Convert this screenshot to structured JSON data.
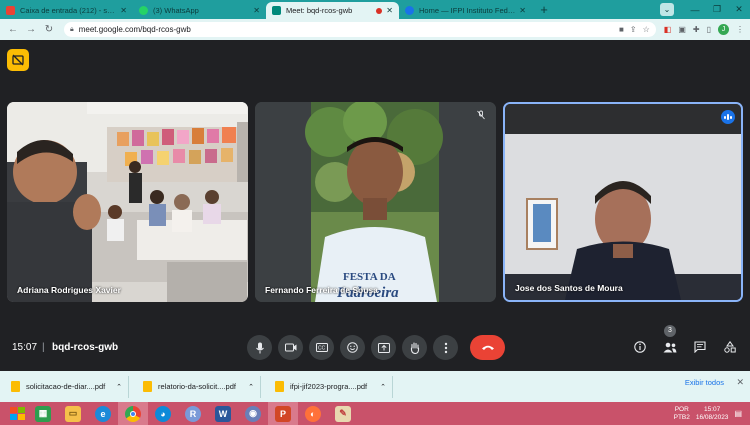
{
  "browser": {
    "tabs": [
      {
        "title": "Caixa de entrada (212) - santos.moura...",
        "icon_color": "#ea4335",
        "active": false
      },
      {
        "title": "(3) WhatsApp",
        "icon_color": "#25d366",
        "active": false
      },
      {
        "title": "Meet: bqd-rcos-gwb",
        "icon_color": "#00897b",
        "active": true,
        "recording": true
      },
      {
        "title": "Home — IFPI Instituto Federal de Edu...",
        "icon_color": "#1a73e8",
        "active": false
      }
    ],
    "url": "meet.google.com/bqd-rcos-gwb",
    "profile_initial": "J"
  },
  "meet": {
    "participants": [
      {
        "name": "Adriana Rodrigues Xavier"
      },
      {
        "name": "Fernando Ferreira de Sousa",
        "muted": true
      },
      {
        "name": "Jose dos Santos de Moura",
        "speaking": true
      }
    ],
    "time": "15:07",
    "separator": "|",
    "meeting_code": "bqd-rcos-gwb",
    "people_count": "3",
    "accent": "#8ab4f8",
    "end_call_color": "#ea4335"
  },
  "downloads": {
    "items": [
      {
        "name": "solicitacao-de-diar....pdf"
      },
      {
        "name": "relatorio-da-solicit....pdf"
      },
      {
        "name": "ifpi-jif2023-progra....pdf"
      }
    ],
    "show_all": "Exibir todos"
  },
  "taskbar": {
    "lang1": "POR",
    "lang2": "PTB2",
    "time": "15:07",
    "date": "16/08/2023"
  }
}
